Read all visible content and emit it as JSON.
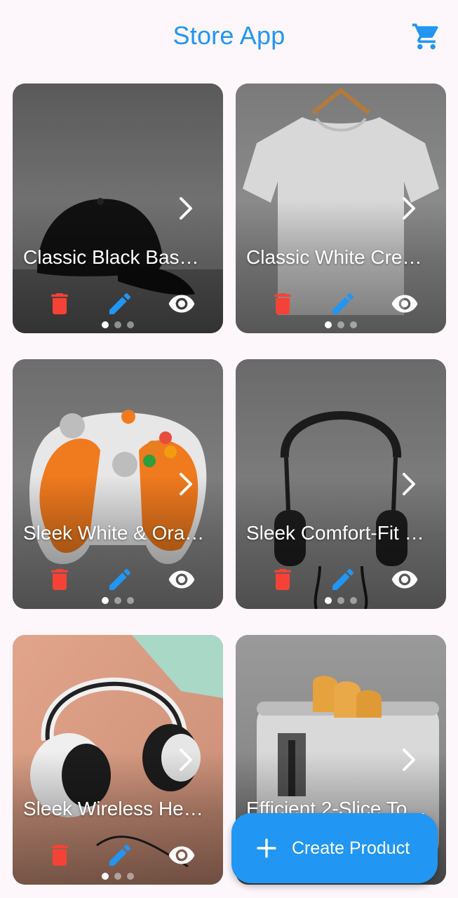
{
  "app_bar": {
    "title": "Store App",
    "cart_icon": "shopping-cart-icon"
  },
  "colors": {
    "accent": "#2196f3",
    "delete": "#f44336",
    "background": "#fdf7fc"
  },
  "products": [
    {
      "title": "Classic Black Bas…",
      "image": "black-baseball-cap",
      "active_image": 1,
      "image_count": 3
    },
    {
      "title": "Classic White Cre…",
      "image": "white-t-shirt-on-hanger",
      "active_image": 1,
      "image_count": 3
    },
    {
      "title": "Sleek White & Ora…",
      "image": "white-orange-game-controller",
      "active_image": 1,
      "image_count": 3
    },
    {
      "title": "Sleek Comfort-Fit …",
      "image": "black-headphones",
      "active_image": 1,
      "image_count": 3
    },
    {
      "title": "Sleek Wireless He…",
      "image": "white-wireless-headphones",
      "active_image": 1,
      "image_count": 3
    },
    {
      "title": "Efficient 2-Slice To…",
      "image": "two-slice-toaster",
      "active_image": 1,
      "image_count": 3
    }
  ],
  "card_icons": {
    "next": "chevron-right-icon",
    "delete": "delete-icon",
    "edit": "edit-icon",
    "view": "eye-icon"
  },
  "fab": {
    "label": "Create Product",
    "icon": "plus-icon"
  }
}
